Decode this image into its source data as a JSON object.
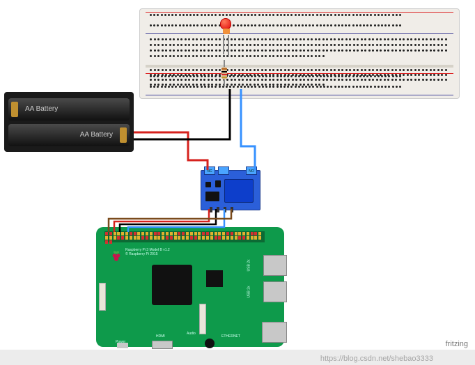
{
  "components": {
    "breadboard": {
      "name": "Breadboard"
    },
    "led": {
      "name": "Red LED",
      "color": "#e20d0d"
    },
    "resistor": {
      "name": "Resistor"
    },
    "battery": {
      "label": "AA Battery"
    },
    "relay": {
      "name": "Relay Module",
      "terminal_nc": "NC",
      "terminal_no": "NO"
    },
    "raspberry_pi": {
      "board_text": "Raspberry Pi 3 Model B v1.2",
      "board_sub": "© Raspberry Pi 2015",
      "ports": {
        "power": "Power",
        "hdmi": "HDMI",
        "audio": "Audio",
        "ethernet": "ETHERNET",
        "usb": "USB 2x"
      }
    }
  },
  "wires": [
    {
      "name": "batt-pos-to-relay-nc",
      "color": "#d6221e"
    },
    {
      "name": "batt-neg-to-breadboard",
      "color": "#000000"
    },
    {
      "name": "relay-no-to-breadboard",
      "color": "#3691ff"
    },
    {
      "name": "pi-5v-to-relay-vcc",
      "color": "#d6221e"
    },
    {
      "name": "pi-gnd-to-relay-gnd",
      "color": "#000000"
    },
    {
      "name": "pi-gpio-to-relay-in",
      "color": "#3691ff"
    },
    {
      "name": "pi-3v3-to-relay",
      "color": "#7a4b1c"
    }
  ],
  "credit": "fritzing",
  "watermark": "https://blog.csdn.net/shebao3333"
}
